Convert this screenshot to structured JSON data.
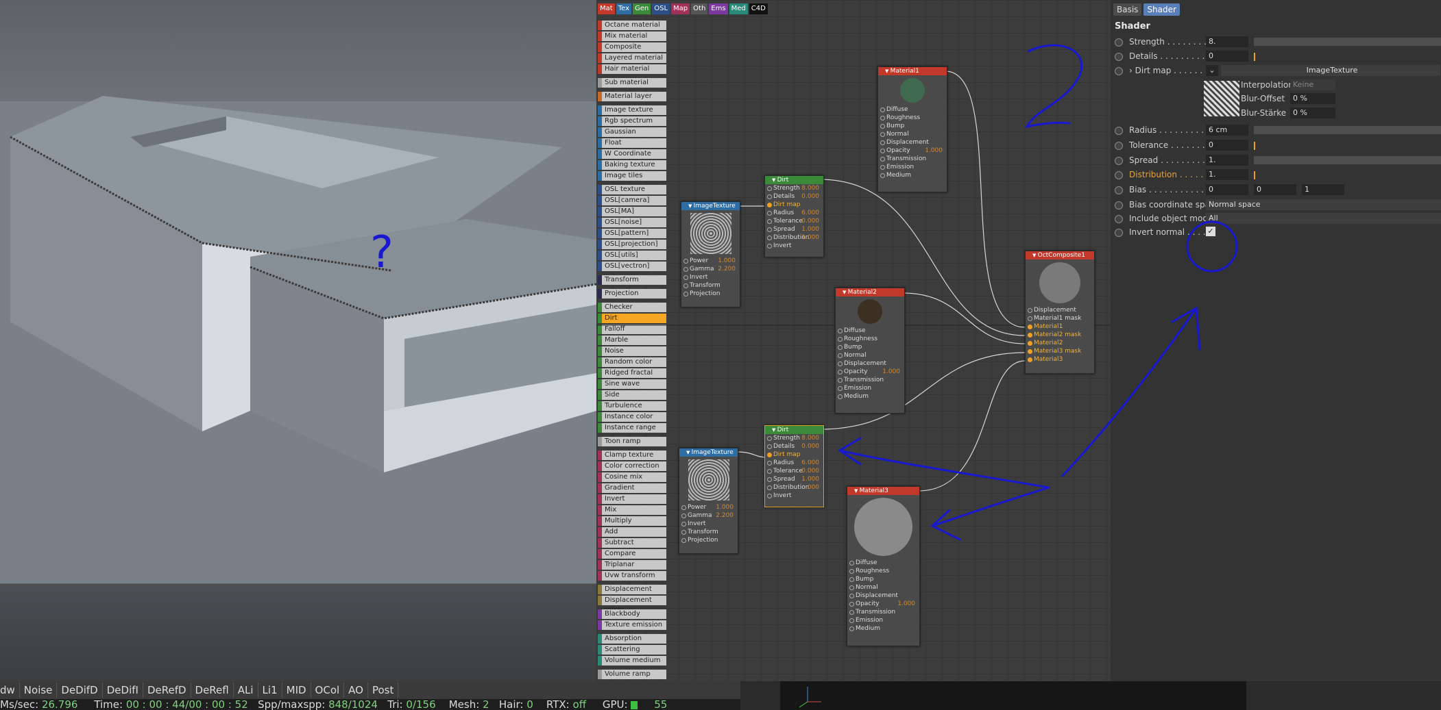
{
  "viewport": {
    "overlay_marks": [
      "?",
      "2",
      "?"
    ]
  },
  "status_bar": {
    "buttons": [
      "dw",
      "Noise",
      "DeDifD",
      "DeDifI",
      "DeRefD",
      "DeRefl",
      "ALi",
      "Li1",
      "MID",
      "OCol",
      "AO",
      "Post"
    ],
    "stats_line": {
      "ms_label": "Ms/sec:",
      "ms_value": "26.796",
      "time_label": "Time:",
      "time_value": "00 : 00 : 44/00 : 00 : 52",
      "spp_label": "Spp/maxspp:",
      "spp_value": "848/1024",
      "tri_label": "Tri:",
      "tri_value": "0/156",
      "mesh_label": "Mesh:",
      "mesh_value": "2",
      "hair_label": "Hair:",
      "hair_value": "0",
      "rtx_label": "RTX:",
      "rtx_value": "off",
      "gpu_label": "GPU:",
      "gpu_value": "55"
    }
  },
  "node_editor": {
    "palette_tabs": [
      {
        "label": "Mat",
        "color": "#c0392b"
      },
      {
        "label": "Tex",
        "color": "#2e6da4"
      },
      {
        "label": "Gen",
        "color": "#3a8a3a"
      },
      {
        "label": "OSL",
        "color": "#2c4f8a"
      },
      {
        "label": "Map",
        "color": "#a0325a"
      },
      {
        "label": "Oth",
        "color": "#555555"
      },
      {
        "label": "Ems",
        "color": "#7a3aa0"
      },
      {
        "label": "Med",
        "color": "#2a8a7a"
      },
      {
        "label": "C4D",
        "color": "#111111"
      }
    ],
    "palette_items": [
      {
        "label": "Octane material",
        "color": "#c0392b"
      },
      {
        "label": "Mix material",
        "color": "#c0392b"
      },
      {
        "label": "Composite material",
        "color": "#c0392b"
      },
      {
        "label": "Layered material",
        "color": "#c0392b"
      },
      {
        "label": "Hair material",
        "color": "#c0392b"
      },
      {
        "gap": true
      },
      {
        "label": "Sub material",
        "color": "#9a9a9a"
      },
      {
        "gap": true
      },
      {
        "label": "Material layer",
        "color": "#c56a2a"
      },
      {
        "gap": true
      },
      {
        "label": "Image texture",
        "color": "#2e6da4"
      },
      {
        "label": "Rgb spectrum",
        "color": "#2e6da4"
      },
      {
        "label": "Gaussian spectrum",
        "color": "#2e6da4"
      },
      {
        "label": "Float",
        "color": "#2e6da4"
      },
      {
        "label": "W Coordinate",
        "color": "#2e6da4"
      },
      {
        "label": "Baking texture",
        "color": "#2e6da4"
      },
      {
        "label": "Image tiles",
        "color": "#2e6da4"
      },
      {
        "gap": true
      },
      {
        "label": "OSL texture",
        "color": "#2c4f8a"
      },
      {
        "label": "OSL[camera]",
        "color": "#2c4f8a"
      },
      {
        "label": "OSL[MA]",
        "color": "#2c4f8a"
      },
      {
        "label": "OSL[noise]",
        "color": "#2c4f8a"
      },
      {
        "label": "OSL[pattern]",
        "color": "#2c4f8a"
      },
      {
        "label": "OSL[projection]",
        "color": "#2c4f8a"
      },
      {
        "label": "OSL[utils]",
        "color": "#2c4f8a"
      },
      {
        "label": "OSL[vectron]",
        "color": "#2c4f8a"
      },
      {
        "gap": true
      },
      {
        "label": "Transform",
        "color": "#2a2a55"
      },
      {
        "gap": true
      },
      {
        "label": "Projection",
        "color": "#2a2a55"
      },
      {
        "gap": true
      },
      {
        "label": "Checker",
        "color": "#3a8a3a"
      },
      {
        "label": "Dirt",
        "color": "#3a8a3a",
        "selected": true
      },
      {
        "label": "Falloff",
        "color": "#3a8a3a"
      },
      {
        "label": "Marble",
        "color": "#3a8a3a"
      },
      {
        "label": "Noise",
        "color": "#3a8a3a"
      },
      {
        "label": "Random color",
        "color": "#3a8a3a"
      },
      {
        "label": "Ridged fractal",
        "color": "#3a8a3a"
      },
      {
        "label": "Sine wave",
        "color": "#3a8a3a"
      },
      {
        "label": "Side",
        "color": "#3a8a3a"
      },
      {
        "label": "Turbulence",
        "color": "#3a8a3a"
      },
      {
        "label": "Instance color",
        "color": "#3a8a3a"
      },
      {
        "label": "Instance range",
        "color": "#3a8a3a"
      },
      {
        "gap": true
      },
      {
        "label": "Toon ramp",
        "color": "#9a9a9a"
      },
      {
        "gap": true
      },
      {
        "label": "Clamp texture",
        "color": "#a0325a"
      },
      {
        "label": "Color correction",
        "color": "#a0325a"
      },
      {
        "label": "Cosine mix",
        "color": "#a0325a"
      },
      {
        "label": "Gradient",
        "color": "#a0325a"
      },
      {
        "label": "Invert",
        "color": "#a0325a"
      },
      {
        "label": "Mix",
        "color": "#a0325a"
      },
      {
        "label": "Multiply",
        "color": "#a0325a"
      },
      {
        "label": "Add",
        "color": "#a0325a"
      },
      {
        "label": "Subtract",
        "color": "#a0325a"
      },
      {
        "label": "Compare",
        "color": "#a0325a"
      },
      {
        "label": "Triplanar",
        "color": "#a0325a"
      },
      {
        "label": "Uvw transform",
        "color": "#a0325a"
      },
      {
        "gap": true
      },
      {
        "label": "Displacement",
        "color": "#8a7a3a"
      },
      {
        "label": "Displacement mixer",
        "color": "#8a7a3a"
      },
      {
        "gap": true
      },
      {
        "label": "Blackbody emission",
        "color": "#7a3aa0"
      },
      {
        "label": "Texture emission",
        "color": "#7a3aa0"
      },
      {
        "gap": true
      },
      {
        "label": "Absorption medium",
        "color": "#2a8a7a"
      },
      {
        "label": "Scattering medium",
        "color": "#2a8a7a"
      },
      {
        "label": "Volume medium",
        "color": "#2a8a7a"
      },
      {
        "gap": true
      },
      {
        "label": "Volume ramp",
        "color": "#9a9a9a"
      }
    ],
    "nodes": {
      "material1": {
        "title": "Material1",
        "rows": [
          "Diffuse",
          "Roughness",
          "Bump",
          "Normal",
          "Displacement",
          "Opacity",
          "Transmission",
          "Emission",
          "Medium"
        ],
        "opacity_value": "1.000"
      },
      "material2": {
        "title": "Material2",
        "rows": [
          "Diffuse",
          "Roughness",
          "Bump",
          "Normal",
          "Displacement",
          "Opacity",
          "Transmission",
          "Emission",
          "Medium"
        ],
        "opacity_value": "1.000"
      },
      "material3": {
        "title": "Material3",
        "rows": [
          "Diffuse",
          "Roughness",
          "Bump",
          "Normal",
          "Displacement",
          "Opacity",
          "Transmission",
          "Emission",
          "Medium"
        ],
        "opacity_value": "1.000"
      },
      "dirt1": {
        "title": "Dirt",
        "rows": [
          {
            "label": "Strength",
            "value": "8.000"
          },
          {
            "label": "Details",
            "value": "0.000"
          },
          {
            "label": "Dirt map",
            "value": "",
            "orange": true
          },
          {
            "label": "Radius",
            "value": "6.000"
          },
          {
            "label": "Tolerance",
            "value": "0.000"
          },
          {
            "label": "Spread",
            "value": "1.000"
          },
          {
            "label": "Distribution",
            "value": "1.000"
          },
          {
            "label": "Invert",
            "value": ""
          }
        ]
      },
      "dirt2": {
        "title": "Dirt",
        "rows": [
          {
            "label": "Strength",
            "value": "8.000"
          },
          {
            "label": "Details",
            "value": "0.000"
          },
          {
            "label": "Dirt map",
            "value": "",
            "orange": true
          },
          {
            "label": "Radius",
            "value": "6.000"
          },
          {
            "label": "Tolerance",
            "value": "0.000"
          },
          {
            "label": "Spread",
            "value": "1.000"
          },
          {
            "label": "Distribution",
            "value": ".000"
          },
          {
            "label": "Invert",
            "value": ""
          }
        ]
      },
      "imgtex1": {
        "title": "ImageTexture",
        "rows": [
          {
            "label": "Power",
            "value": "1.000"
          },
          {
            "label": "Gamma",
            "value": "2.200"
          },
          {
            "label": "Invert",
            "value": ""
          },
          {
            "label": "Transform",
            "value": ""
          },
          {
            "label": "Projection",
            "value": ""
          }
        ]
      },
      "imgtex2": {
        "title": "ImageTexture",
        "rows": [
          {
            "label": "Power",
            "value": "1.000"
          },
          {
            "label": "Gamma",
            "value": "2.200"
          },
          {
            "label": "Invert",
            "value": ""
          },
          {
            "label": "Transform",
            "value": ""
          },
          {
            "label": "Projection",
            "value": ""
          }
        ]
      },
      "composite": {
        "title": "OctComposite1",
        "rows": [
          {
            "label": "Displacement"
          },
          {
            "label": "Material1 mask"
          },
          {
            "label": "Material1",
            "orange": true
          },
          {
            "label": "Material2 mask",
            "orange": true
          },
          {
            "label": "Material2",
            "orange": true
          },
          {
            "label": "Material3 mask",
            "orange": true
          },
          {
            "label": "Material3",
            "orange": true
          }
        ]
      }
    }
  },
  "attributes": {
    "tabs": [
      "Basis",
      "Shader"
    ],
    "active_tab": "Shader",
    "section_title": "Shader",
    "rows": {
      "strength": {
        "label": "Strength . . . . . . . . .",
        "value": "8."
      },
      "details": {
        "label": "Details . . . . . . . . . .",
        "value": "0"
      },
      "dirt_map": {
        "label": "Dirt map . . . . . . .",
        "value": "ImageTexture"
      },
      "interpolation": {
        "label": "Interpolation",
        "value": "Keine"
      },
      "blur_offset": {
        "label": "Blur-Offset",
        "value": "0 %"
      },
      "blur_staerke": {
        "label": "Blur-Stärke",
        "value": "0 %"
      },
      "radius": {
        "label": "Radius . . . . . . . . . .",
        "value": "6 cm"
      },
      "tolerance": {
        "label": "Tolerance . . . . . . . .",
        "value": "0"
      },
      "spread": {
        "label": "Spread . . . . . . . . . .",
        "value": "1."
      },
      "distribution": {
        "label": "Distribution . . . . . .",
        "value": "1."
      },
      "bias": {
        "label": "Bias . . . . . . . . . . . .",
        "values": [
          "0",
          "0",
          "1"
        ]
      },
      "bias_space": {
        "label": "Bias coordinate space",
        "value": "Normal space"
      },
      "include_mode": {
        "label": "Include object mode",
        "value": "All"
      },
      "invert_normal": {
        "label": "Invert normal . . . . .",
        "checked": true
      }
    }
  },
  "colors": {
    "annotation_ink": "#1818d0",
    "accent_orange": "#f0a020",
    "selected_tab": "#5a7fb8"
  }
}
